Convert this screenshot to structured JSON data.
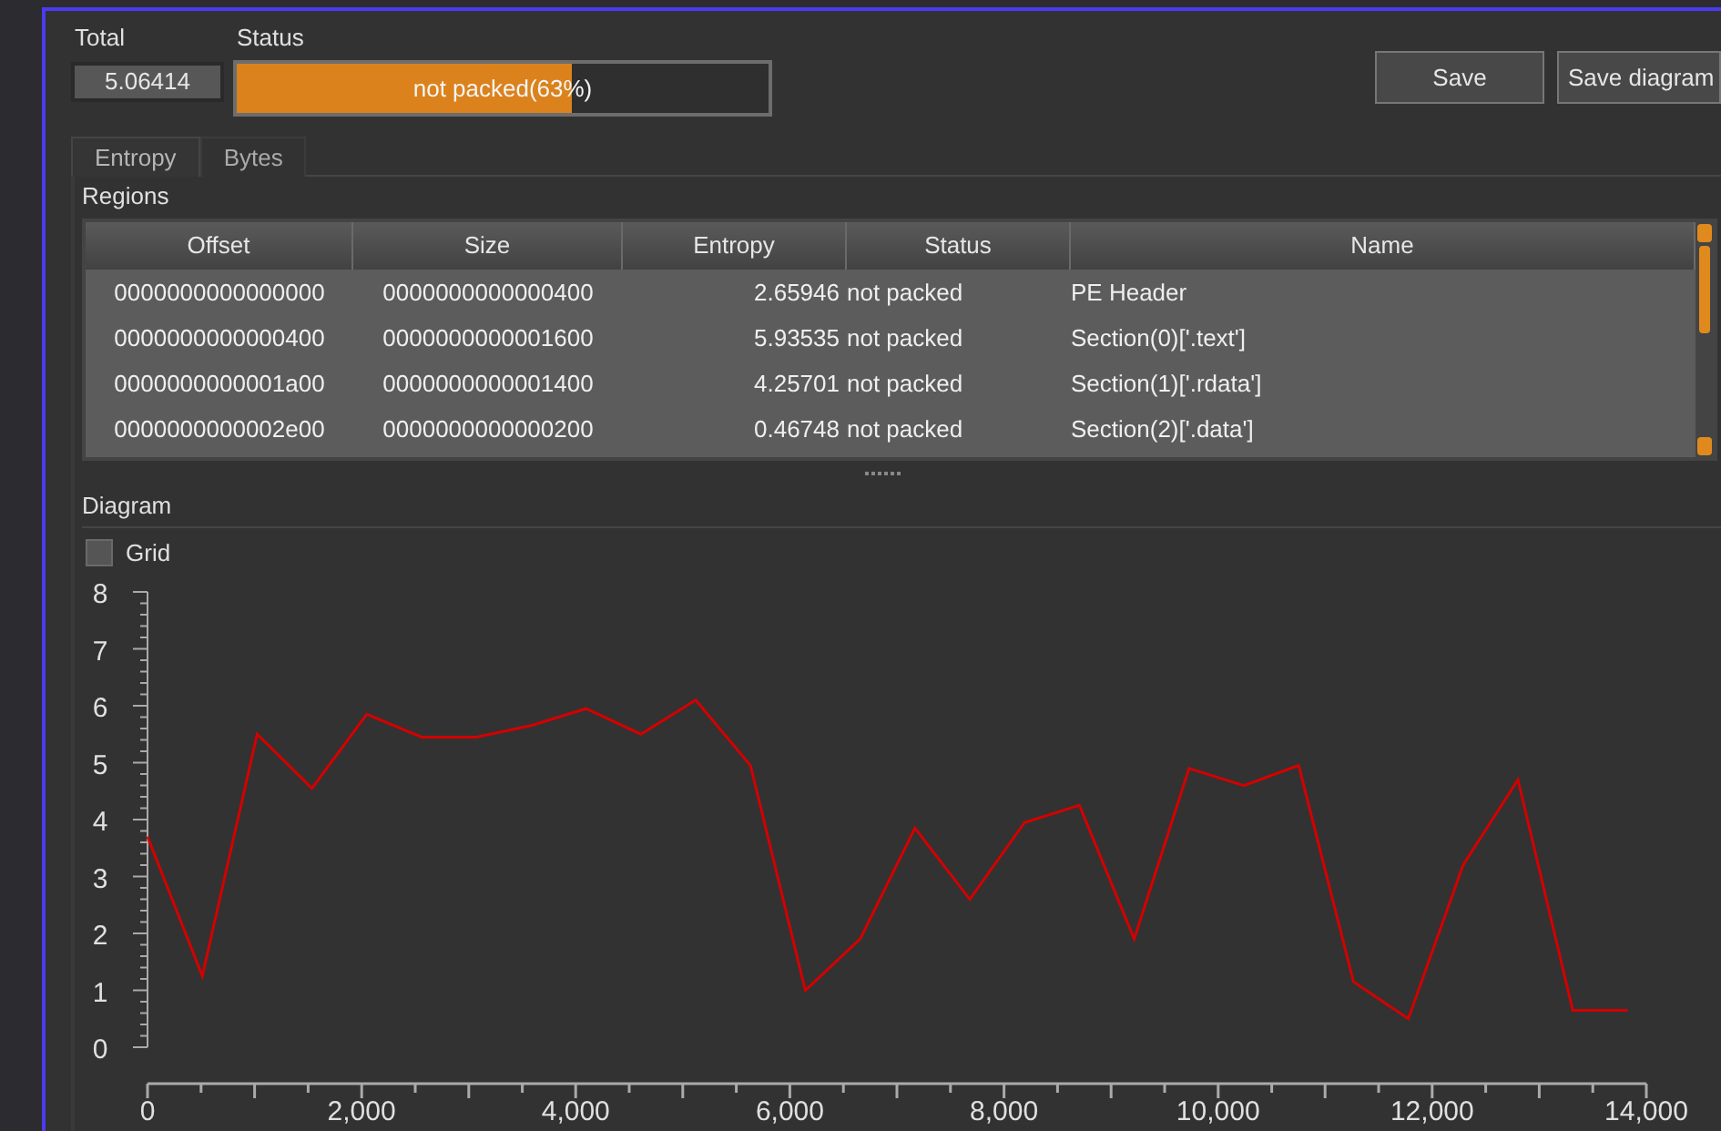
{
  "total": {
    "label": "Total",
    "value": "5.06414"
  },
  "status": {
    "label": "Status",
    "text": "not packed(63%)",
    "level": 0.63
  },
  "buttons": [
    "Save",
    "Save diagram"
  ],
  "tabs": [
    {
      "label": "Entropy",
      "selected": true
    },
    {
      "label": "Bytes",
      "selected": false
    }
  ],
  "regions": {
    "title": "Regions",
    "columns": [
      "Offset",
      "Size",
      "Entropy",
      "Status",
      "Name"
    ],
    "rows": [
      [
        "0000000000000000",
        "0000000000000400",
        "2.65946",
        "not packed",
        "PE Header"
      ],
      [
        "0000000000000400",
        "0000000000001600",
        "5.93535",
        "not packed",
        "Section(0)['.text']"
      ],
      [
        "0000000000001a00",
        "0000000000001400",
        "4.25701",
        "not packed",
        "Section(1)['.rdata']"
      ],
      [
        "0000000000002e00",
        "0000000000000200",
        "0.46748",
        "not packed",
        "Section(2)['.data']"
      ]
    ]
  },
  "diagram": {
    "title": "Diagram",
    "grid": {
      "label": "Grid",
      "checked": false
    },
    "chart_data": {
      "type": "line",
      "xlim": [
        0,
        14000
      ],
      "ylim": [
        0,
        8
      ],
      "xticks": [
        {
          "value": 0,
          "label": "0"
        },
        {
          "value": 2000,
          "label": "2,000"
        },
        {
          "value": 4000,
          "label": "4,000"
        },
        {
          "value": 6000,
          "label": "6,000"
        },
        {
          "value": 8000,
          "label": "8,000"
        },
        {
          "value": 10000,
          "label": "10,000"
        },
        {
          "value": 12000,
          "label": "12,000"
        },
        {
          "value": 14000,
          "label": "14,000"
        }
      ],
      "yticks": [
        0,
        1,
        2,
        3,
        4,
        5,
        6,
        7,
        8
      ],
      "x": [
        0,
        512,
        1024,
        1536,
        2048,
        2560,
        3072,
        3584,
        4096,
        4608,
        5120,
        5632,
        6144,
        6656,
        7168,
        7680,
        8192,
        8704,
        9216,
        9728,
        10240,
        10752,
        11264,
        11776,
        12288,
        12800,
        13312,
        13824
      ],
      "series": [
        {
          "color": "#d40000",
          "values": [
            3.7,
            1.25,
            5.5,
            4.55,
            5.85,
            5.45,
            5.45,
            5.65,
            5.95,
            5.5,
            6.1,
            4.95,
            1.0,
            1.9,
            3.85,
            2.6,
            3.95,
            4.25,
            1.9,
            4.9,
            4.6,
            4.95,
            1.15,
            0.5,
            3.2,
            4.7,
            0.65,
            0.65
          ]
        }
      ]
    }
  }
}
